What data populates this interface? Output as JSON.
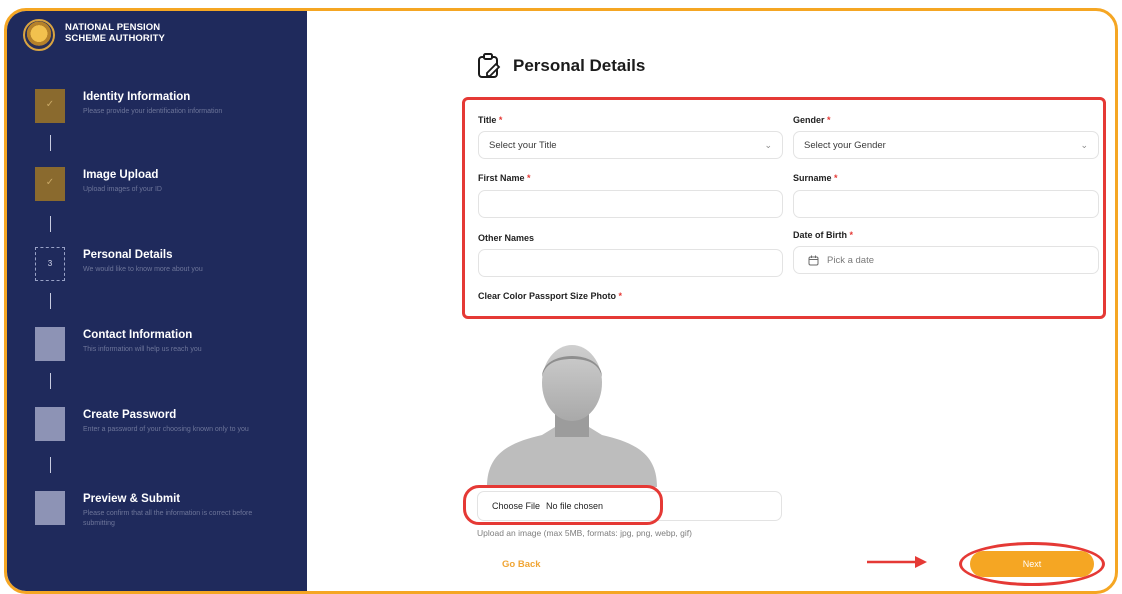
{
  "brand": {
    "line1": "NATIONAL PENSION",
    "line2": "SCHEME AUTHORITY"
  },
  "steps": [
    {
      "title": "Identity Information",
      "desc": "Please provide your identification information",
      "status": "done"
    },
    {
      "title": "Image Upload",
      "desc": "Upload images of your ID",
      "status": "done"
    },
    {
      "title": "Personal Details",
      "desc": "We would like to know more about you",
      "status": "current",
      "number": "3"
    },
    {
      "title": "Contact Information",
      "desc": "This information will help us reach you",
      "status": "todo"
    },
    {
      "title": "Create Password",
      "desc": "Enter a password of your choosing known only to you",
      "status": "todo"
    },
    {
      "title": "Preview & Submit",
      "desc": "Please confirm that all the information is correct before submitting",
      "status": "todo"
    }
  ],
  "page": {
    "title": "Personal Details"
  },
  "form": {
    "title_label": "Title",
    "title_placeholder": "Select your Title",
    "gender_label": "Gender",
    "gender_placeholder": "Select your Gender",
    "first_name_label": "First Name",
    "first_name_value": "",
    "surname_label": "Surname",
    "surname_value": "",
    "other_names_label": "Other Names",
    "other_names_value": "",
    "dob_label": "Date of Birth",
    "dob_placeholder": "Pick a date",
    "photo_label": "Clear Color Passport Size Photo",
    "required_mark": "*"
  },
  "upload": {
    "choose_label": "Choose File",
    "status": "No file chosen",
    "hint": "Upload an image (max 5MB, formats: jpg, png, webp, gif)"
  },
  "nav": {
    "back_label": "Go Back",
    "next_label": "Next"
  },
  "colors": {
    "sidebar": "#1f2a5c",
    "accent": "#f5a623",
    "highlight": "#e53935",
    "done": "#8a6a2e"
  }
}
